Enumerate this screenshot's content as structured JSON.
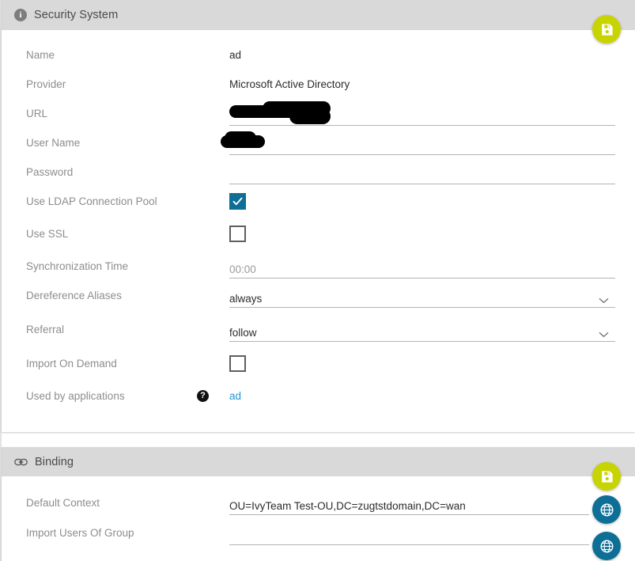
{
  "security_card": {
    "title": "Security System",
    "icon": "info-icon",
    "save_button": {
      "icon": "save-icon",
      "title": "Save"
    },
    "fields": [
      {
        "label": "Name",
        "value": "ad",
        "kind": "text"
      },
      {
        "label": "Provider",
        "value": "Microsoft Active Directory",
        "kind": "text"
      },
      {
        "label": "URL",
        "value": "",
        "kind": "input-redacted"
      },
      {
        "label": "User Name",
        "value": "",
        "kind": "input-redacted"
      },
      {
        "label": "Password",
        "value": "",
        "kind": "input"
      },
      {
        "label": "Use LDAP Connection Pool",
        "value": "checked",
        "kind": "checkbox"
      },
      {
        "label": "Use SSL",
        "value": "unchecked",
        "kind": "checkbox"
      },
      {
        "label": "Synchronization Time",
        "value": "00:00",
        "kind": "input-placeholder"
      },
      {
        "label": "Dereference Aliases",
        "value": "always",
        "kind": "select"
      },
      {
        "label": "Referral",
        "value": "follow",
        "kind": "select"
      },
      {
        "label": "Import On Demand",
        "value": "unchecked",
        "kind": "checkbox"
      },
      {
        "label": "Used by applications",
        "value": "ad",
        "kind": "link",
        "help": "?"
      }
    ]
  },
  "binding_card": {
    "title": "Binding",
    "icon": "link-icon",
    "save_button": {
      "icon": "save-icon",
      "title": "Save"
    },
    "fields": [
      {
        "label": "Default Context",
        "value": "OU=IvyTeam Test-OU,DC=zugtstdomain,DC=wan",
        "kind": "input",
        "action_icon": "globe-icon"
      },
      {
        "label": "Import Users Of Group",
        "value": "",
        "kind": "input",
        "action_icon": "globe-icon"
      }
    ]
  },
  "colors": {
    "header_bg": "#d9d9d9",
    "save_accent": "#c8d400",
    "globe_accent": "#0d6e96",
    "checkbox_checked": "#0d6e96",
    "link": "#2196d6",
    "label": "#8d8d8d",
    "value": "#2b2b2b"
  }
}
